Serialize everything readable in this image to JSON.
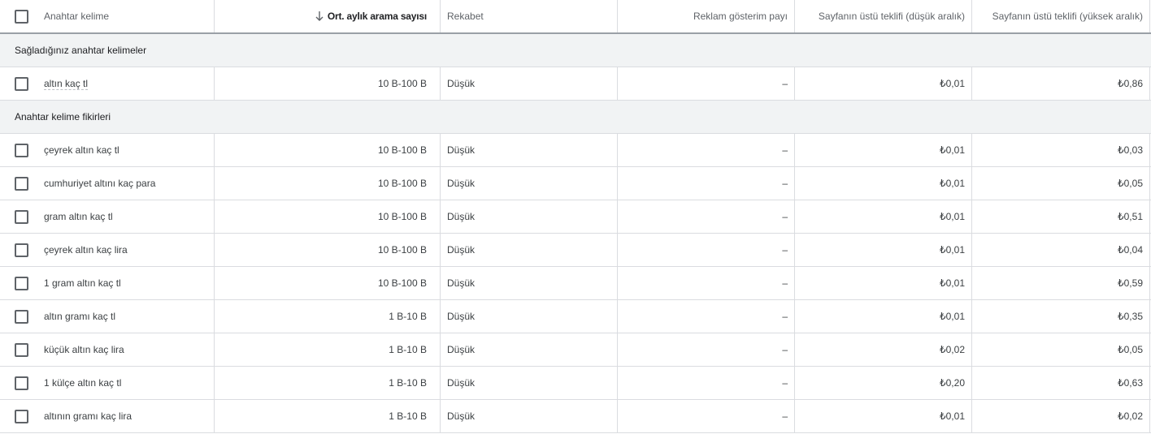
{
  "header": {
    "keyword": "Anahtar kelime",
    "avg_monthly": "Ort. aylık arama sayısı",
    "competition": "Rekabet",
    "impression_share": "Reklam gösterim payı",
    "top_bid_low": "Sayfanın üstü teklifi (düşük aralık)",
    "top_bid_high": "Sayfanın üstü teklifi (yüksek aralık)"
  },
  "sections": {
    "provided": "Sağladığınız anahtar kelimeler",
    "ideas": "Anahtar kelime fikirleri"
  },
  "provided_rows": [
    {
      "keyword": "altın kaç tl",
      "avg": "10 B-100 B",
      "competition": "Düşük",
      "share": "–",
      "low": "₺0,01",
      "high": "₺0,86"
    }
  ],
  "idea_rows": [
    {
      "keyword": "çeyrek altın kaç tl",
      "avg": "10 B-100 B",
      "competition": "Düşük",
      "share": "–",
      "low": "₺0,01",
      "high": "₺0,03"
    },
    {
      "keyword": "cumhuriyet altını kaç para",
      "avg": "10 B-100 B",
      "competition": "Düşük",
      "share": "–",
      "low": "₺0,01",
      "high": "₺0,05"
    },
    {
      "keyword": "gram altın kaç tl",
      "avg": "10 B-100 B",
      "competition": "Düşük",
      "share": "–",
      "low": "₺0,01",
      "high": "₺0,51"
    },
    {
      "keyword": "çeyrek altın kaç lira",
      "avg": "10 B-100 B",
      "competition": "Düşük",
      "share": "–",
      "low": "₺0,01",
      "high": "₺0,04"
    },
    {
      "keyword": "1 gram altın kaç tl",
      "avg": "10 B-100 B",
      "competition": "Düşük",
      "share": "–",
      "low": "₺0,01",
      "high": "₺0,59"
    },
    {
      "keyword": "altın gramı kaç tl",
      "avg": "1 B-10 B",
      "competition": "Düşük",
      "share": "–",
      "low": "₺0,01",
      "high": "₺0,35"
    },
    {
      "keyword": "küçük altın kaç lira",
      "avg": "1 B-10 B",
      "competition": "Düşük",
      "share": "–",
      "low": "₺0,02",
      "high": "₺0,05"
    },
    {
      "keyword": "1 külçe altın kaç tl",
      "avg": "1 B-10 B",
      "competition": "Düşük",
      "share": "–",
      "low": "₺0,20",
      "high": "₺0,63"
    },
    {
      "keyword": "altının gramı kaç lira",
      "avg": "1 B-10 B",
      "competition": "Düşük",
      "share": "–",
      "low": "₺0,01",
      "high": "₺0,02"
    }
  ]
}
